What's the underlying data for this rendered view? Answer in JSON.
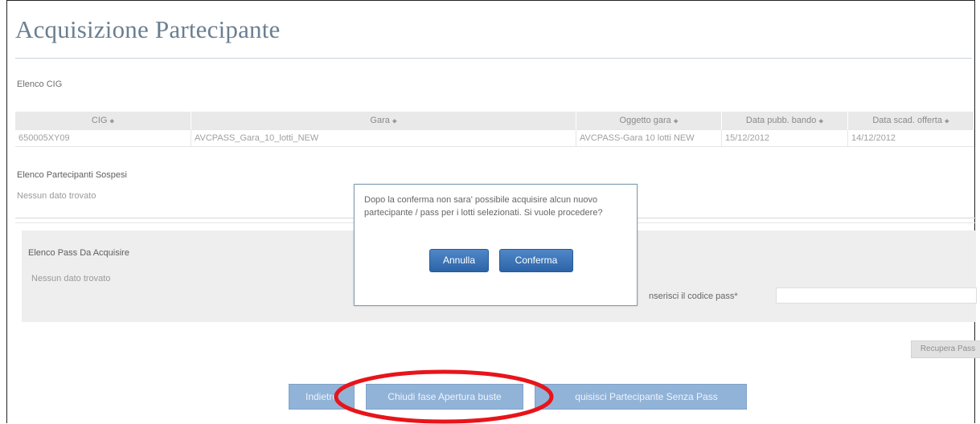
{
  "page_title": "Acquisizione Partecipante",
  "sections": {
    "cig": "Elenco CIG",
    "sospesi": "Elenco Partecipanti Sospesi",
    "sospesi_empty": "Nessun dato trovato",
    "pass": "Elenco Pass Da Acquisire",
    "pass_empty": "Nessun dato trovato"
  },
  "cig_table": {
    "columns": [
      "CIG",
      "Gara",
      "Oggetto gara",
      "Data pubb. bando",
      "Data scad. offerta"
    ],
    "sort_icon": "⬥",
    "rows": [
      [
        "650005XY09",
        "AVCPASS_Gara_10_lotti_NEW",
        "AVCPASS-Gara 10 lotti NEW",
        "15/12/2012",
        "14/12/2012"
      ]
    ]
  },
  "pass_form": {
    "label": "nserisci il codice pass*",
    "value": "",
    "recupera_button": "Recupera Pass"
  },
  "footer_buttons": {
    "indietro": "Indietro",
    "chiudi": "Chiudi fase Apertura buste",
    "acquisisci": "Acquisisci Partecipante Senza Pass"
  },
  "footer_partial": {
    "indietro_visible": "Indietro",
    "acquisisci_visible": "quisisci Partecipante Senza Pass"
  },
  "modal": {
    "message": "Dopo la conferma non sara' possibile acquisire alcun nuovo partecipante / pass per i lotti selezionati. Si vuole procedere?",
    "cancel_label": "Annulla",
    "confirm_label": "Conferma"
  },
  "colors": {
    "primary_button": "#2d64a8",
    "annotation": "#e8141a",
    "title": "#6b7f90"
  }
}
